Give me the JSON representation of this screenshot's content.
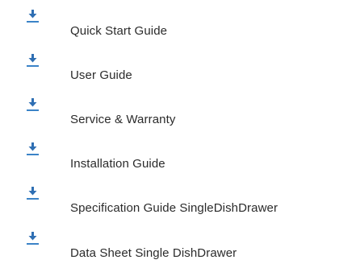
{
  "downloads": {
    "items": [
      {
        "label": "Quick Start Guide",
        "icon": "download-icon"
      },
      {
        "label": "User Guide",
        "icon": "download-icon"
      },
      {
        "label": "Service & Warranty",
        "icon": "download-icon"
      },
      {
        "label": "Installation Guide",
        "icon": "download-icon"
      },
      {
        "label": "Specification Guide SingleDishDrawer",
        "icon": "download-icon"
      },
      {
        "label": "Data Sheet Single DishDrawer",
        "icon": "download-icon"
      }
    ]
  },
  "colors": {
    "icon_arrow": "#2f6fb3",
    "icon_baseline": "#3b83c7",
    "text": "#2b2b2b",
    "background": "#ffffff"
  }
}
